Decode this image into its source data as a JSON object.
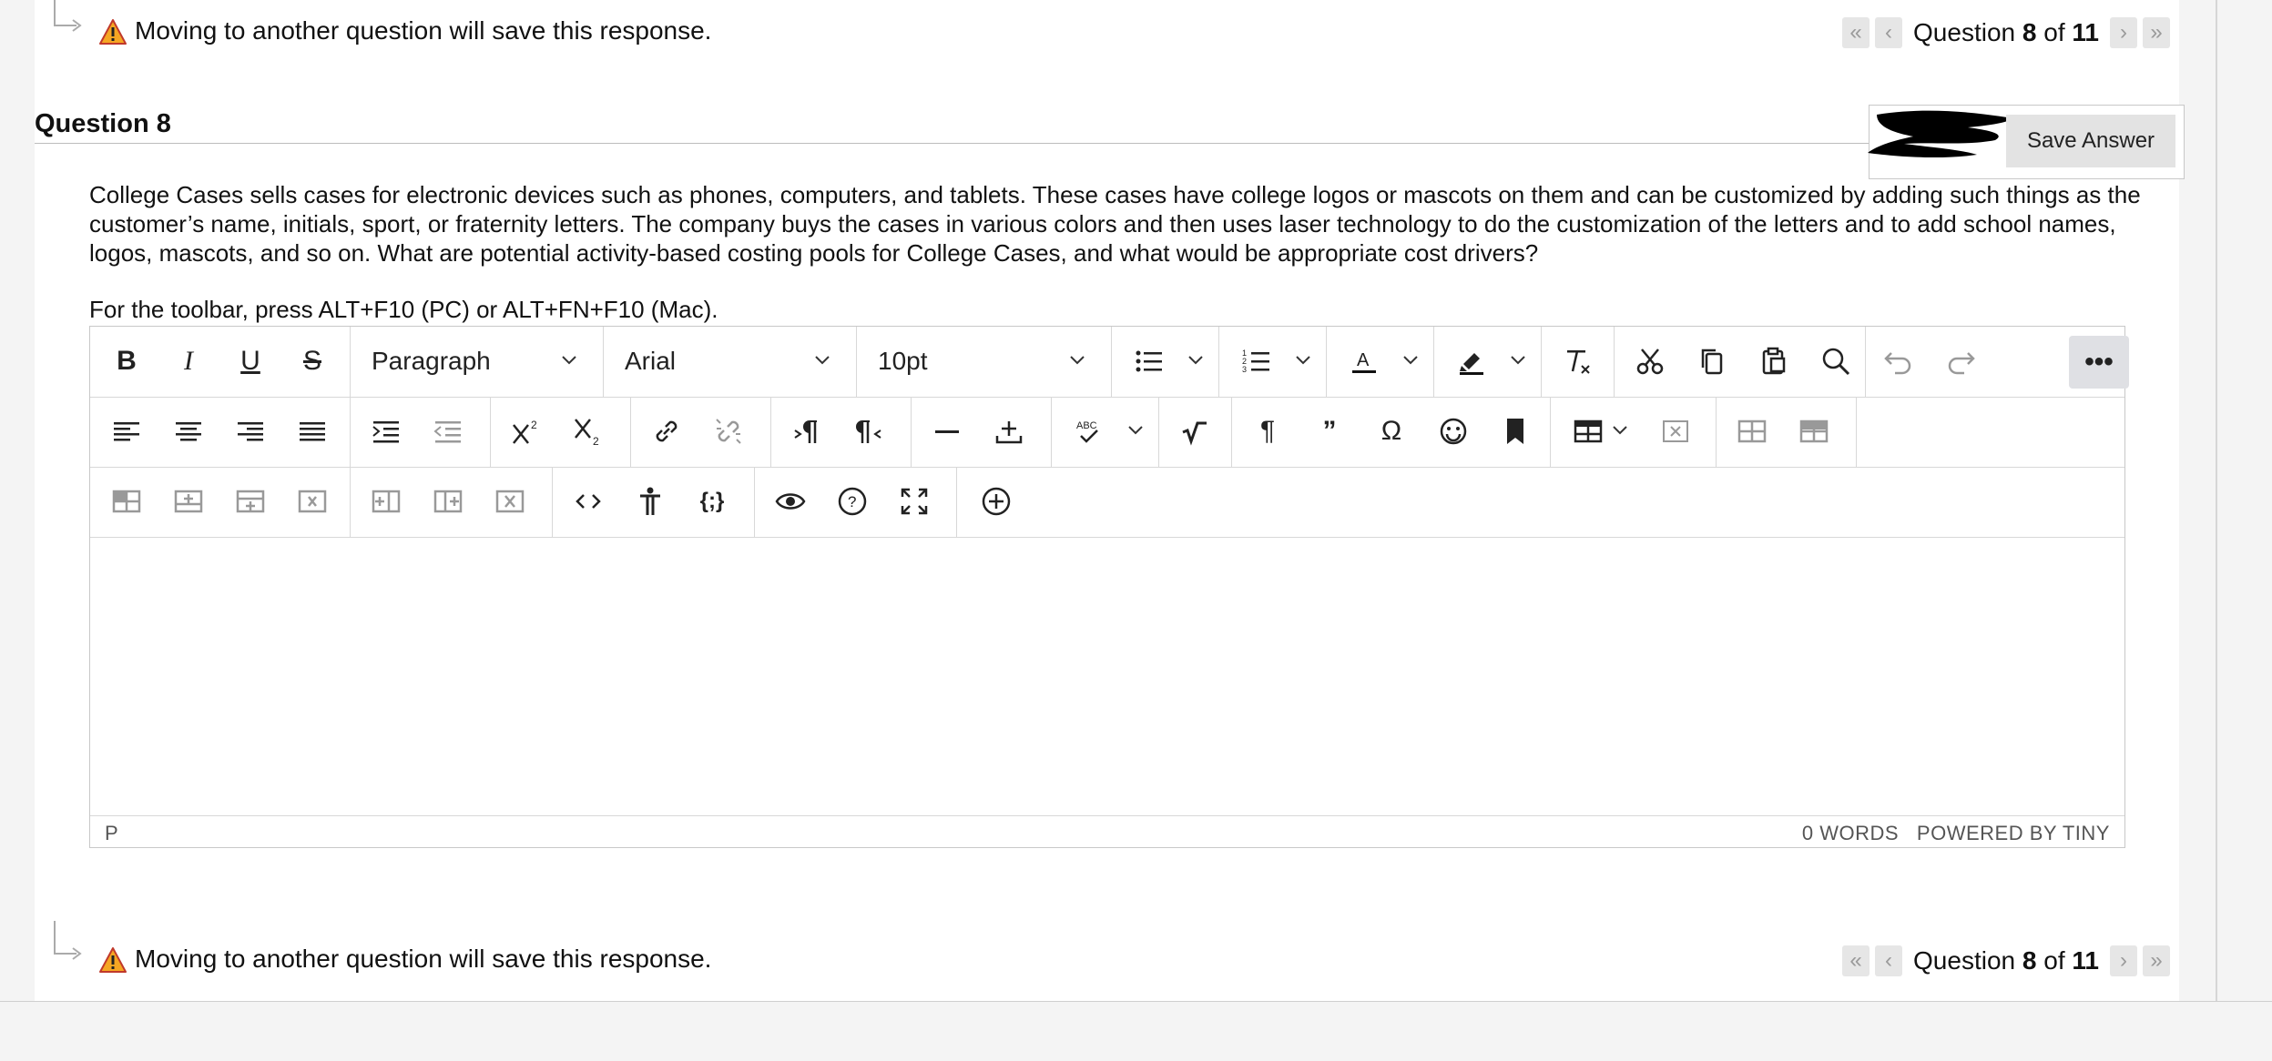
{
  "warning": {
    "text": "Moving to another question will save this response."
  },
  "navigation": {
    "question_label_prefix": "Question",
    "current": "8",
    "of_label": "of",
    "total": "11"
  },
  "question": {
    "title": "Question 8",
    "save_label": "Save Answer",
    "body": "College Cases sells cases for electronic devices such as phones, computers, and tablets. These cases have college logos or mascots on them and can be customized by adding such things as the customer’s name, initials, sport, or fraternity letters. The company buys the cases in various colors and then uses laser technology to do the customization of the letters and to add school names, logos, mascots, and so on. What are potential activity-based costing pools for College Cases, and what would be appropriate cost drivers?",
    "toolbar_hint": "For the toolbar, press ALT+F10 (PC) or ALT+FN+F10 (Mac)."
  },
  "editor": {
    "block_format": "Paragraph",
    "font_family": "Arial",
    "font_size": "10pt",
    "status_path": "P",
    "word_count": "0 WORDS",
    "powered_by": "POWERED BY TINY",
    "content": ""
  },
  "colors": {
    "accent_warning": "#f5a623",
    "button_bg": "#e3e3e3",
    "border": "#c8c8c8"
  }
}
